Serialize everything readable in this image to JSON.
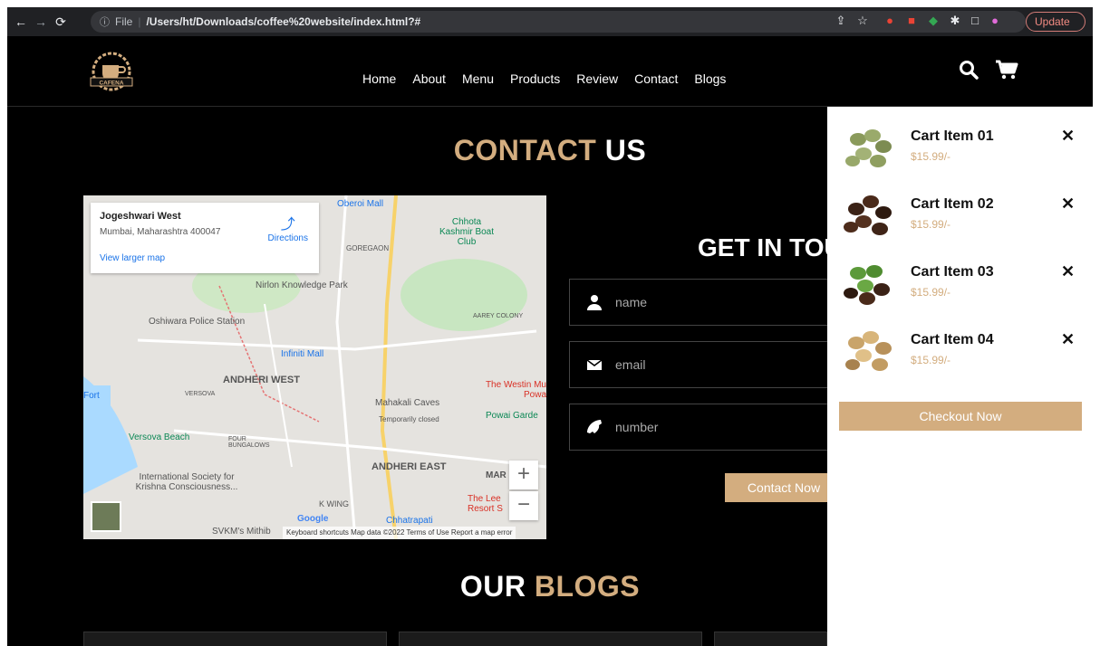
{
  "browser": {
    "url_scheme": "File",
    "url": "/Users/ht/Downloads/coffee%20website/index.html?#",
    "update_label": "Update"
  },
  "site": {
    "logo_text": "CAFENA",
    "menu": [
      "Home",
      "About",
      "Menu",
      "Products",
      "Review",
      "Contact",
      "Blogs"
    ]
  },
  "contact": {
    "title_accent": "CONTACT",
    "title_rest": "US",
    "form_title": "GET IN TOU",
    "name_placeholder": "name",
    "email_placeholder": "email",
    "number_placeholder": "number",
    "submit_label": "Contact Now"
  },
  "map": {
    "place": "Jogeshwari West",
    "address": "Mumbai, Maharashtra 400047",
    "directions": "Directions",
    "larger_map": "View larger map",
    "footer": "Keyboard shortcuts   Map data ©2022   Terms of Use   Report a map error",
    "labels": {
      "oberoi": "Oberoi Mall",
      "chhota": "Chhota Kashmir Boat Club",
      "goregaon": "GOREGAON",
      "nirlon": "Nirlon Knowledge Park",
      "oshiwara": "Oshiwara Police Station",
      "aarey": "AAREY COLONY",
      "infiniti": "Infiniti Mall",
      "andheri_w": "ANDHERI WEST",
      "versova": "VERSOVA",
      "fort": "Fort",
      "mahakali": "Mahakali Caves",
      "temp_closed": "Temporarily closed",
      "westin": "The Westin Mu Powa",
      "powai": "Powai Garde",
      "versova_beach": "Versova Beach",
      "four_bungalows": "FOUR BUNGALOWS",
      "andheri_e": "ANDHERI EAST",
      "iskcon": "International Society for Krishna Consciousness...",
      "kwing": "K WING",
      "chhatrapati": "Chhatrapati",
      "leela": "The Lee Resort S",
      "svkm": "SVKM's Mithib",
      "google": "Google",
      "mar": "MAR"
    }
  },
  "cart": {
    "items": [
      {
        "name": "Cart Item 01",
        "price": "$15.99/-"
      },
      {
        "name": "Cart Item 02",
        "price": "$15.99/-"
      },
      {
        "name": "Cart Item 03",
        "price": "$15.99/-"
      },
      {
        "name": "Cart Item 04",
        "price": "$15.99/-"
      }
    ],
    "remove_glyph": "✕",
    "checkout_label": "Checkout Now"
  },
  "blogs": {
    "title_rest": "OUR",
    "title_accent": "BLOGS"
  },
  "colors": {
    "accent": "#d3ad7f",
    "background": "#000000"
  }
}
